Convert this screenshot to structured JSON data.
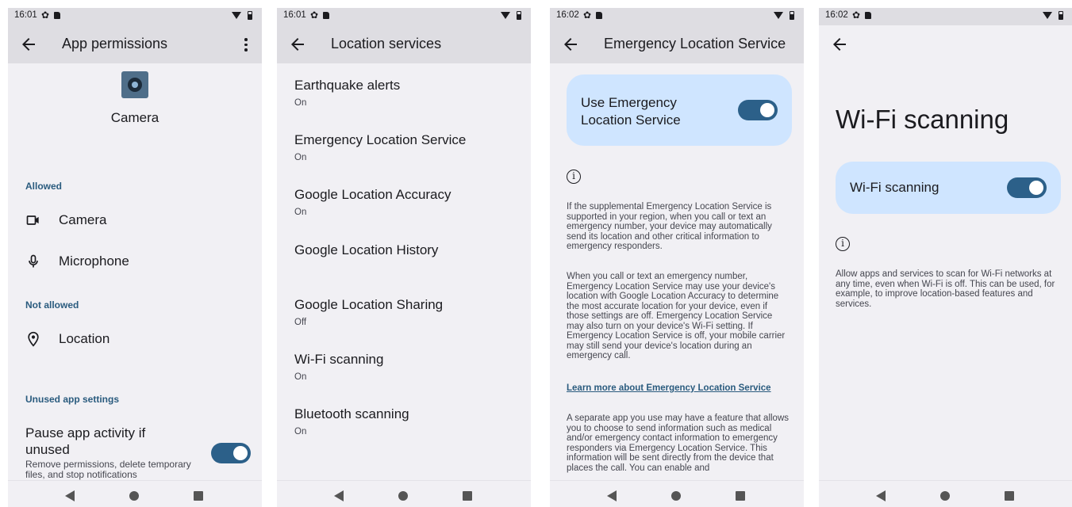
{
  "colors": {
    "accent": "#2c6089",
    "card_bg": "#cfe5ff",
    "screen_bg": "#f1f0f4",
    "header_bg": "#dedde2",
    "link": "#2a5b7e"
  },
  "screens": [
    {
      "status": {
        "time": "16:01"
      },
      "title": "App permissions",
      "app_name": "Camera",
      "allowed_header": "Allowed",
      "allowed": [
        {
          "label": "Camera",
          "icon": "videocam-icon"
        },
        {
          "label": "Microphone",
          "icon": "mic-icon"
        }
      ],
      "not_allowed_header": "Not allowed",
      "not_allowed": [
        {
          "label": "Location",
          "icon": "location-pin-icon"
        }
      ],
      "unused_header": "Unused app settings",
      "pause": {
        "title": "Pause app activity if unused",
        "desc": "Remove permissions, delete temporary files, and stop notifications",
        "enabled": true
      }
    },
    {
      "status": {
        "time": "16:01"
      },
      "title": "Location services",
      "items": [
        {
          "title": "Earthquake alerts",
          "sub": "On"
        },
        {
          "title": "Emergency Location Service",
          "sub": "On"
        },
        {
          "title": "Google Location Accuracy",
          "sub": "On"
        },
        {
          "title": "Google Location History",
          "sub": ""
        },
        {
          "title": "Google Location Sharing",
          "sub": "Off"
        },
        {
          "title": "Wi-Fi scanning",
          "sub": "On"
        },
        {
          "title": "Bluetooth scanning",
          "sub": "On"
        }
      ]
    },
    {
      "status": {
        "time": "16:02"
      },
      "title": "Emergency Location Service",
      "toggle_label": "Use Emergency Location Service",
      "toggle_on": true,
      "para1": "If the supplemental Emergency Location Service is supported in your region, when you call or text an emergency number, your device may automatically send its location and other critical information to emergency responders.",
      "para2": "When you call or text an emergency number, Emergency Location Service may use your device's location with Google Location Accuracy to determine the most accurate location for your device, even if those settings are off. Emergency Location Service may also turn on your device's Wi-Fi setting. If Emergency Location Service is off, your mobile carrier may still send your device's location during an emergency call.",
      "link": "Learn more about Emergency Location Service",
      "para3": "A separate app you use may have a feature that allows you to choose to send information such as medical and/or emergency contact information to emergency responders via Emergency Location Service. This information will be sent directly from the device that places the call. You can enable and"
    },
    {
      "status": {
        "time": "16:02"
      },
      "title": "Wi-Fi scanning",
      "toggle_label": "Wi-Fi scanning",
      "toggle_on": true,
      "desc": "Allow apps and services to scan for Wi-Fi networks at any time, even when Wi-Fi is off. This can be used, for example, to improve location-based features and services."
    }
  ]
}
